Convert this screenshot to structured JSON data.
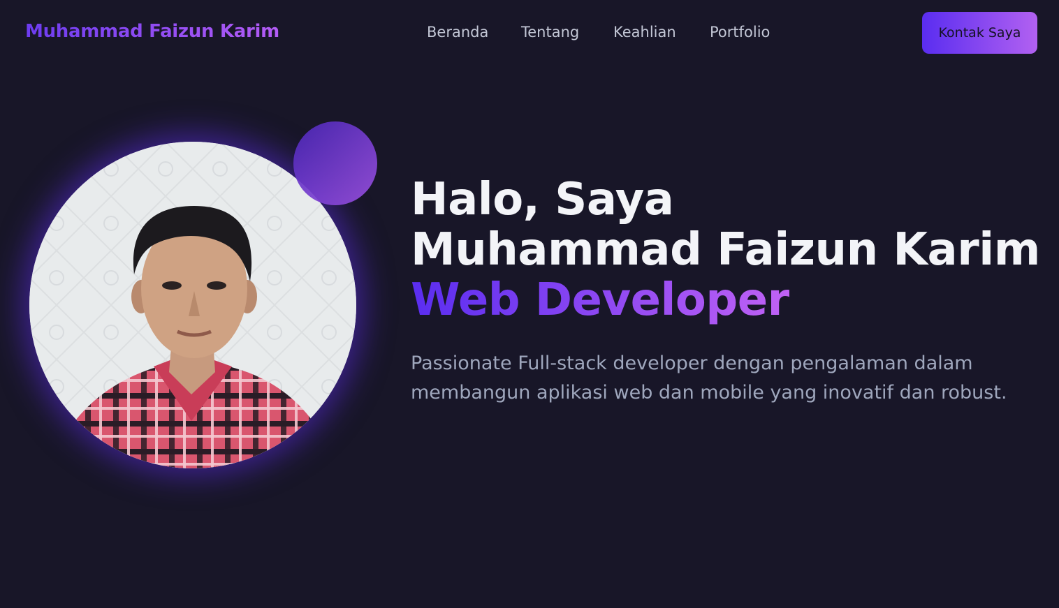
{
  "nav": {
    "brand": "Muhammad Faizun Karim",
    "items": [
      {
        "label": "Beranda"
      },
      {
        "label": "Tentang"
      },
      {
        "label": "Keahlian"
      },
      {
        "label": "Portfolio"
      }
    ],
    "cta_label": "Kontak Saya"
  },
  "hero": {
    "greeting": "Halo, Saya",
    "name": "Muhammad Faizun Karim",
    "role": "Web Developer",
    "description": "Passionate Full-stack developer dengan pengalaman dalam membangun aplikasi web dan mobile yang inovatif dan robust."
  },
  "colors": {
    "background": "#181628",
    "accent_start": "#5a2df0",
    "accent_end": "#c062f5",
    "text_primary": "#f3f4f8",
    "text_muted": "#9fa7bd"
  }
}
